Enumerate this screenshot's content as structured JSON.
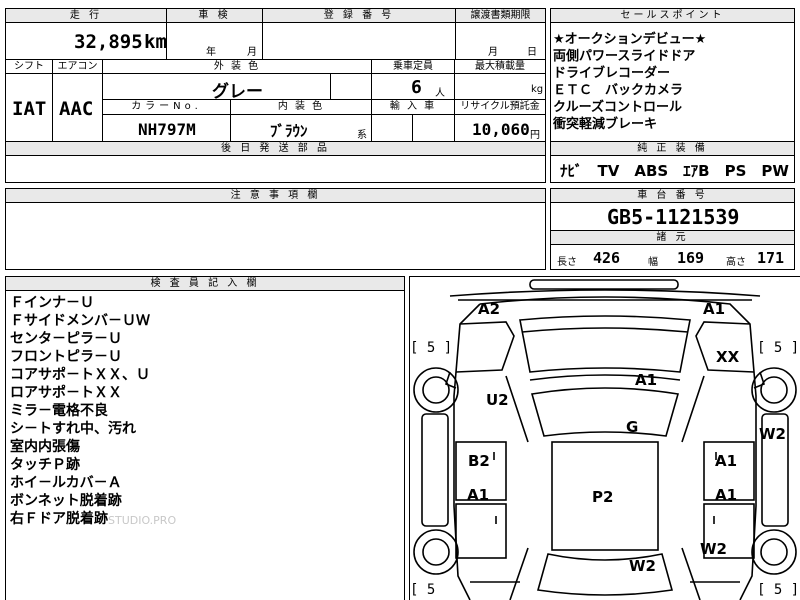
{
  "top_row": {
    "mileage_header": "走 行",
    "mileage_value": "32,895",
    "mileage_unit": "km",
    "inspection_header": "車 検",
    "inspection_year": "年",
    "inspection_month": "月",
    "registration_header": "登 録 番 号",
    "transfer_header": "譲渡書類期限",
    "transfer_month": "月",
    "transfer_day": "日",
    "sales_points_header": "セールスポイント"
  },
  "middle_row": {
    "shift_header": "シフト",
    "shift_value": "IAT",
    "ac_header": "エアコン",
    "ac_value": "AAC",
    "exterior_color_header": "外 装 色",
    "exterior_color_value": "グレー",
    "capacity_header": "乗車定員",
    "capacity_value": "6",
    "capacity_unit": "人",
    "max_load_header": "最大積載量",
    "max_load_unit": "kg",
    "color_no_header": "カラーNo.",
    "color_no_value": "NH797M",
    "interior_color_header": "内 装 色",
    "interior_color_value": "ﾌﾞﾗｳﾝ",
    "interior_color_suffix": "系",
    "import_header": "輸 入 車",
    "recycle_header": "リサイクル預託金",
    "recycle_value": "10,060",
    "recycle_unit": "円",
    "later_parts_header": "後 日 発 送 部 品"
  },
  "sales_points": [
    "★オークションデビュー★",
    "両側パワースライドドア",
    "ドライブレコーダー",
    "ＥＴＣ　バックカメラ",
    "クルーズコントロール",
    "衝突軽減ブレーキ"
  ],
  "equipment": {
    "header": "純 正 装 備",
    "value": "ﾅﾋﾞ　TV　ABS　ｴｱB　PS　PW"
  },
  "notes": {
    "header": "注 意 事 項 欄"
  },
  "chassis": {
    "header": "車 台 番 号",
    "value": "GB5-1121539",
    "specs_header": "諸 元",
    "length_label": "長さ",
    "length_value": "426",
    "width_label": "幅",
    "width_value": "169",
    "height_label": "高さ",
    "height_value": "171"
  },
  "inspector": {
    "header": "検 査 員 記 入 欄",
    "remarks": [
      "Ｆインナ－Ｕ",
      "Ｆサイドメンバ－ＵＷ",
      "センタ－ピラ－Ｕ",
      "フロントピラ－Ｕ",
      "コアサポ－トＸＸ、Ｕ",
      "ロアサポ－トＸＸ",
      "ミラ－電格不良",
      "シ－トすれ中、汚れ",
      "室内内張傷",
      "タッチＰ跡",
      "ホイ－ルカバ－Ａ",
      "ボンネット脱着跡",
      "右Ｆドア脱着跡"
    ],
    "watermark": "STUDIO.PRO"
  },
  "car_map": {
    "marks": {
      "a2_front_left": "A2",
      "a1_front_right": "A1",
      "xx_right_front": "XX",
      "a1_hood": "A1",
      "u2_left_fender": "U2",
      "g_windshield": "G",
      "w2_right_side": "W2",
      "b2_left_front_door": "B2",
      "a1_right_front_door": "A1",
      "a1_left_rear_door": "A1",
      "p2_roof": "P2",
      "a1_right_rear_door": "A1",
      "w2_right_rear": "W2",
      "w2_rear": "W2"
    },
    "tire_tl": "[ 5 ]",
    "tire_tr": "[ 5 ]",
    "tire_bl": "[ 5",
    "tire_br": "[ 5 ]"
  }
}
